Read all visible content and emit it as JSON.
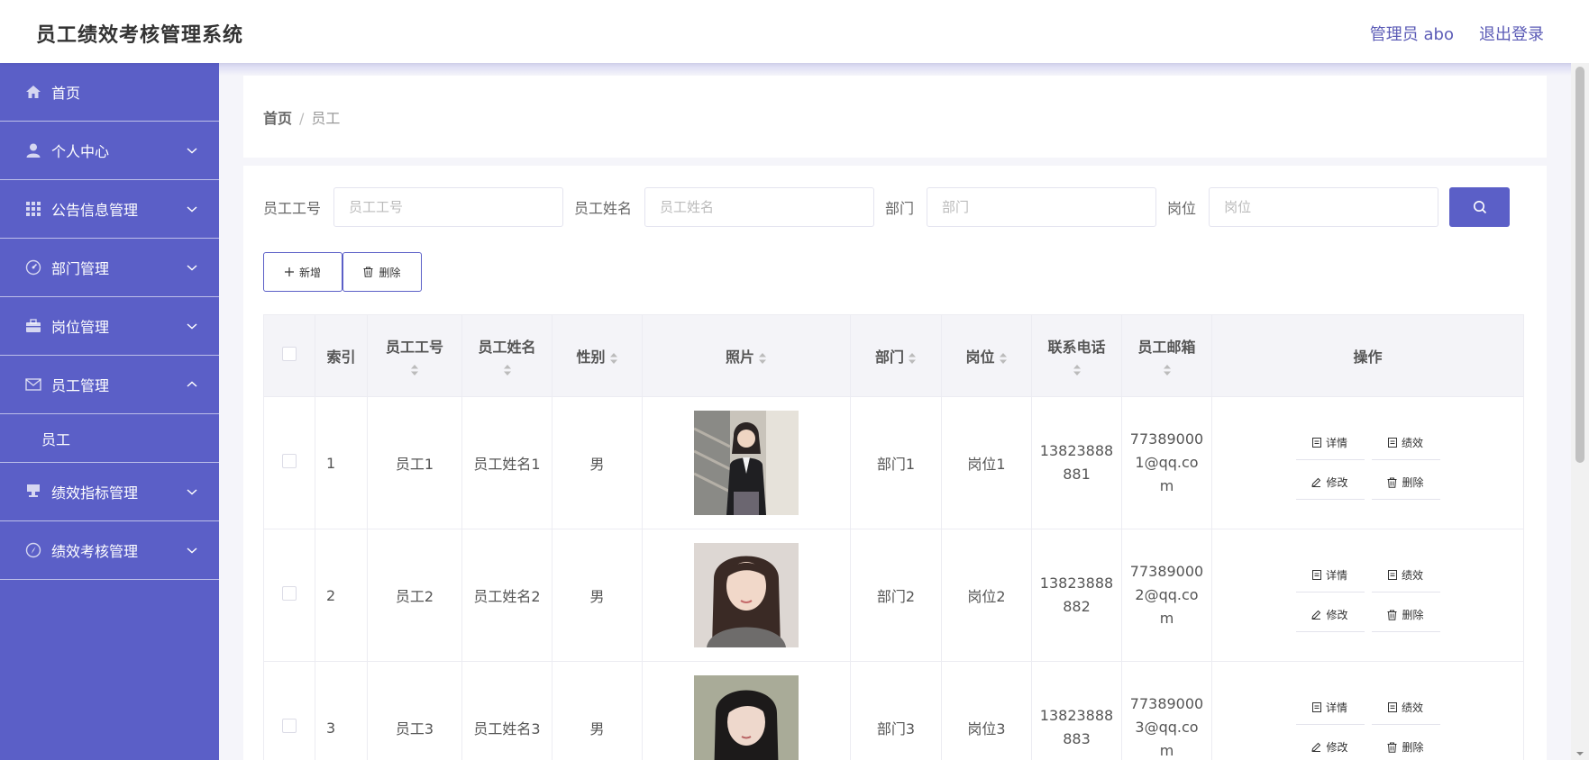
{
  "header": {
    "title": "员工绩效考核管理系统",
    "user": "管理员 abo",
    "logout": "退出登录"
  },
  "sidebar": {
    "items": [
      {
        "label": "首页",
        "icon": "home-icon",
        "expandable": false
      },
      {
        "label": "个人中心",
        "icon": "user-icon",
        "expandable": true
      },
      {
        "label": "公告信息管理",
        "icon": "grid-icon",
        "expandable": true
      },
      {
        "label": "部门管理",
        "icon": "gauge-icon",
        "expandable": true
      },
      {
        "label": "岗位管理",
        "icon": "briefcase-icon",
        "expandable": true
      },
      {
        "label": "员工管理",
        "icon": "mail-icon",
        "expandable": true,
        "expanded": true,
        "children": [
          "员工"
        ]
      },
      {
        "label": "绩效指标管理",
        "icon": "stamp-icon",
        "expandable": true
      },
      {
        "label": "绩效考核管理",
        "icon": "compass-icon",
        "expandable": true
      }
    ]
  },
  "breadcrumb": {
    "home": "首页",
    "separator": "/",
    "current": "员工"
  },
  "search": {
    "fields": [
      {
        "label": "员工工号",
        "placeholder": "员工工号"
      },
      {
        "label": "员工姓名",
        "placeholder": "员工姓名"
      },
      {
        "label": "部门",
        "placeholder": "部门"
      },
      {
        "label": "岗位",
        "placeholder": "岗位"
      }
    ]
  },
  "actions": {
    "add": "新增",
    "delete": "删除"
  },
  "table": {
    "columns": [
      "索引",
      "员工工号",
      "员工姓名",
      "性别",
      "照片",
      "部门",
      "岗位",
      "联系电话",
      "员工邮箱",
      "操作"
    ],
    "rows": [
      {
        "index": "1",
        "emp_no": "员工1",
        "name": "员工姓名1",
        "gender": "男",
        "dept": "部门1",
        "post": "岗位1",
        "phone_a": "13823888",
        "phone_b": "881",
        "email_a": "77389000",
        "email_b": "1@qq.co",
        "email_c": "m"
      },
      {
        "index": "2",
        "emp_no": "员工2",
        "name": "员工姓名2",
        "gender": "男",
        "dept": "部门2",
        "post": "岗位2",
        "phone_a": "13823888",
        "phone_b": "882",
        "email_a": "77389000",
        "email_b": "2@qq.co",
        "email_c": "m"
      },
      {
        "index": "3",
        "emp_no": "员工3",
        "name": "员工姓名3",
        "gender": "男",
        "dept": "部门3",
        "post": "岗位3",
        "phone_a": "13823888",
        "phone_b": "883",
        "email_a": "77389000",
        "email_b": "3@qq.co",
        "email_c": "m"
      }
    ],
    "ops": {
      "detail": "详情",
      "perf": "绩效",
      "edit": "修改",
      "del": "删除"
    }
  },
  "colors": {
    "primary": "#5b5fc7",
    "background": "#f5f5fa"
  }
}
